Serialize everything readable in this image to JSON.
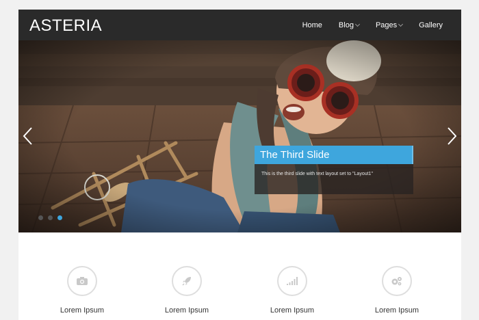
{
  "header": {
    "logo": "ASTERIA",
    "nav": [
      {
        "label": "Home"
      },
      {
        "label": "Blog"
      },
      {
        "label": "Pages"
      },
      {
        "label": "Gallery"
      }
    ]
  },
  "slider": {
    "caption_title": "The Third Slide",
    "caption_text": "This is the third slide with text layout set to \"Layout1\"",
    "active_slide": 3,
    "slide_count": 3
  },
  "features": [
    {
      "title": "Lorem Ipsum",
      "icon": "camera-icon"
    },
    {
      "title": "Lorem Ipsum",
      "icon": "rocket-icon"
    },
    {
      "title": "Lorem Ipsum",
      "icon": "signal-icon"
    },
    {
      "title": "Lorem Ipsum",
      "icon": "gears-icon"
    }
  ],
  "colors": {
    "header_bg": "#2a2a2a",
    "accent": "#3ea6dd",
    "icon_gray": "#c9c9c9"
  }
}
